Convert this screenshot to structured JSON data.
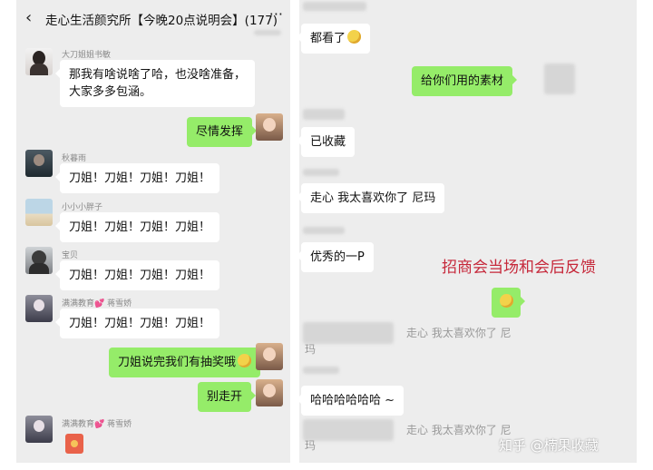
{
  "left_chat": {
    "title": "走心生活颜究所【今晚20点说明会】(177)",
    "back_glyph": "‹",
    "more_glyph": "···",
    "messages": [
      {
        "sender": "大刀姐姐书敏",
        "lines": [
          "那我有啥说啥了哈，也没啥准备，",
          "大家多多包涵。"
        ]
      },
      {
        "self": true,
        "text": "尽情发挥"
      },
      {
        "sender": "秋暮雨",
        "text": "刀姐！刀姐！刀姐！刀姐！"
      },
      {
        "sender": "小小小胖子",
        "text": "刀姐！刀姐！刀姐！刀姐！"
      },
      {
        "sender": "宝贝",
        "text": "刀姐！刀姐！刀姐！刀姐！"
      },
      {
        "sender": "满满教育💕 蒋雪娇",
        "text": "刀姐！刀姐！刀姐！刀姐！"
      },
      {
        "self": true,
        "text": "刀姐说完我们有抽奖哦"
      },
      {
        "self": true,
        "text": "别走开"
      },
      {
        "sender": "满满教育💕 蒋雪娇",
        "text": ""
      }
    ]
  },
  "right_chat": {
    "messages": [
      {
        "text": "都看了"
      },
      {
        "self": true,
        "text": "给你们用的素材"
      },
      {
        "text": "已收藏"
      },
      {
        "text": "走心 我太喜欢你了 尼玛"
      },
      {
        "text": "优秀的一P"
      },
      {
        "self": true,
        "text": ""
      },
      {
        "partial": true,
        "text": "走心 我太喜欢你了 尼",
        "tail": "玛"
      },
      {
        "text": "哈哈哈哈哈哈 ~"
      },
      {
        "partial": true,
        "text": "走心 我太喜欢你了 尼",
        "tail": "玛"
      }
    ]
  },
  "annotation": "招商会当场和会后反馈",
  "watermark": "知乎 @楠果收藏",
  "colors": {
    "chat_bg": "#ededed",
    "self_bubble": "#95ec69",
    "other_bubble": "#ffffff",
    "annotation": "#c6283a"
  },
  "icons": [
    "back-arrow-icon",
    "more-icon",
    "emoji-face-icon",
    "red-packet-icon"
  ]
}
